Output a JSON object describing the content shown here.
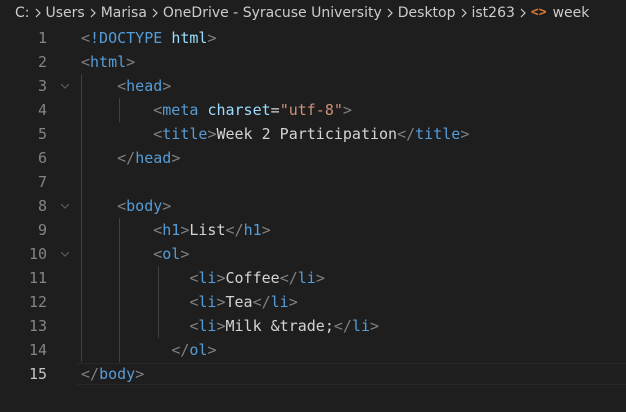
{
  "breadcrumb": {
    "items": [
      {
        "label": "C:"
      },
      {
        "label": "Users"
      },
      {
        "label": "Marisa"
      },
      {
        "label": "OneDrive - Syracuse University"
      },
      {
        "label": "Desktop"
      },
      {
        "label": "ist263"
      },
      {
        "label": "week"
      }
    ],
    "separator_icon": "chevron-right-icon",
    "file_icon": "code-brackets-icon",
    "file_icon_color": "#e37933"
  },
  "editor": {
    "active_line": "15",
    "lines": [
      {
        "num": "1",
        "tokens": [
          [
            "punc",
            "<"
          ],
          [
            "tag",
            "!DOCTYPE"
          ],
          [
            "text",
            " "
          ],
          [
            "attr",
            "html"
          ],
          [
            "punc",
            ">"
          ]
        ]
      },
      {
        "num": "2",
        "tokens": [
          [
            "punc",
            "<"
          ],
          [
            "tag",
            "html"
          ],
          [
            "punc",
            ">"
          ]
        ]
      },
      {
        "num": "3",
        "tokens": [
          [
            "text",
            "    "
          ],
          [
            "punc",
            "<"
          ],
          [
            "tag",
            "head"
          ],
          [
            "punc",
            ">"
          ]
        ]
      },
      {
        "num": "4",
        "tokens": [
          [
            "text",
            "        "
          ],
          [
            "punc",
            "<"
          ],
          [
            "tag",
            "meta"
          ],
          [
            "text",
            " "
          ],
          [
            "attr",
            "charset"
          ],
          [
            "text",
            "="
          ],
          [
            "str",
            "\"utf-8\""
          ],
          [
            "punc",
            ">"
          ]
        ]
      },
      {
        "num": "5",
        "tokens": [
          [
            "text",
            "        "
          ],
          [
            "punc",
            "<"
          ],
          [
            "tag",
            "title"
          ],
          [
            "punc",
            ">"
          ],
          [
            "text",
            "Week 2 Participation"
          ],
          [
            "punc",
            "</"
          ],
          [
            "tag",
            "title"
          ],
          [
            "punc",
            ">"
          ]
        ]
      },
      {
        "num": "6",
        "tokens": [
          [
            "text",
            "    "
          ],
          [
            "punc",
            "</"
          ],
          [
            "tag",
            "head"
          ],
          [
            "punc",
            ">"
          ]
        ]
      },
      {
        "num": "7",
        "tokens": []
      },
      {
        "num": "8",
        "tokens": [
          [
            "text",
            "    "
          ],
          [
            "punc",
            "<"
          ],
          [
            "tag",
            "body"
          ],
          [
            "punc",
            ">"
          ]
        ]
      },
      {
        "num": "9",
        "tokens": [
          [
            "text",
            "        "
          ],
          [
            "punc",
            "<"
          ],
          [
            "tag",
            "h1"
          ],
          [
            "punc",
            ">"
          ],
          [
            "text",
            "List"
          ],
          [
            "punc",
            "</"
          ],
          [
            "tag",
            "h1"
          ],
          [
            "punc",
            ">"
          ]
        ]
      },
      {
        "num": "10",
        "tokens": [
          [
            "text",
            "        "
          ],
          [
            "punc",
            "<"
          ],
          [
            "tag",
            "ol"
          ],
          [
            "punc",
            ">"
          ]
        ]
      },
      {
        "num": "11",
        "tokens": [
          [
            "text",
            "            "
          ],
          [
            "punc",
            "<"
          ],
          [
            "tag",
            "li"
          ],
          [
            "punc",
            ">"
          ],
          [
            "text",
            "Coffee"
          ],
          [
            "punc",
            "</"
          ],
          [
            "tag",
            "li"
          ],
          [
            "punc",
            ">"
          ]
        ]
      },
      {
        "num": "12",
        "tokens": [
          [
            "text",
            "            "
          ],
          [
            "punc",
            "<"
          ],
          [
            "tag",
            "li"
          ],
          [
            "punc",
            ">"
          ],
          [
            "text",
            "Tea"
          ],
          [
            "punc",
            "</"
          ],
          [
            "tag",
            "li"
          ],
          [
            "punc",
            ">"
          ]
        ]
      },
      {
        "num": "13",
        "tokens": [
          [
            "text",
            "            "
          ],
          [
            "punc",
            "<"
          ],
          [
            "tag",
            "li"
          ],
          [
            "punc",
            ">"
          ],
          [
            "text",
            "Milk &trade;"
          ],
          [
            "punc",
            "</"
          ],
          [
            "tag",
            "li"
          ],
          [
            "punc",
            ">"
          ]
        ]
      },
      {
        "num": "14",
        "tokens": [
          [
            "text",
            "          "
          ],
          [
            "punc",
            "</"
          ],
          [
            "tag",
            "ol"
          ],
          [
            "punc",
            ">"
          ]
        ]
      },
      {
        "num": "15",
        "tokens": [
          [
            "punc",
            "</"
          ],
          [
            "tag",
            "body"
          ],
          [
            "punc",
            ">"
          ]
        ]
      }
    ],
    "foldable_lines": [
      "3",
      "8",
      "10"
    ],
    "colors": {
      "background": "#1e1e1e",
      "punctuation": "#808080",
      "tag": "#569cd6",
      "attribute": "#9cdcfe",
      "string": "#ce9178",
      "text": "#d4d4d4",
      "line_number": "#858585",
      "active_line_number": "#c6c6c6"
    }
  }
}
